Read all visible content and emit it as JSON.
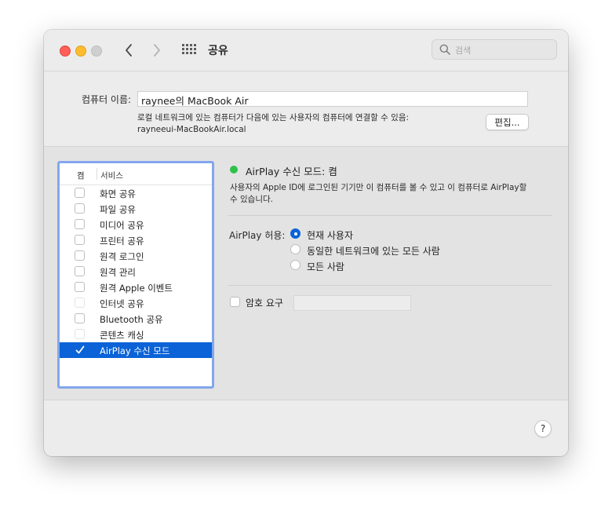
{
  "window": {
    "title": "공유"
  },
  "search": {
    "placeholder": "검색"
  },
  "computer_name": {
    "label": "컴퓨터 이름:",
    "value": "raynee의 MacBook Air",
    "description_line1": "로컬 네트워크에 있는 컴퓨터가 다음에 있는 사용자의 컴퓨터에 연결할 수 있음:",
    "description_line2": "rayneeui-MacBookAir.local",
    "edit_label": "편집..."
  },
  "services": {
    "header_on": "켬",
    "header_service": "서비스",
    "items": [
      {
        "label": "화면 공유",
        "checked": false,
        "dim": false
      },
      {
        "label": "파일 공유",
        "checked": false,
        "dim": false
      },
      {
        "label": "미디어 공유",
        "checked": false,
        "dim": false
      },
      {
        "label": "프린터 공유",
        "checked": false,
        "dim": false
      },
      {
        "label": "원격 로그인",
        "checked": false,
        "dim": false
      },
      {
        "label": "원격 관리",
        "checked": false,
        "dim": false
      },
      {
        "label": "원격 Apple 이벤트",
        "checked": false,
        "dim": false
      },
      {
        "label": "인터넷 공유",
        "checked": false,
        "dim": true
      },
      {
        "label": "Bluetooth 공유",
        "checked": false,
        "dim": false
      },
      {
        "label": "콘텐츠 캐싱",
        "checked": false,
        "dim": true
      },
      {
        "label": "AirPlay 수신 모드",
        "checked": true,
        "dim": false,
        "selected": true
      }
    ]
  },
  "detail": {
    "status": "AirPlay 수신 모드: 켬",
    "status_color": "#2ec14a",
    "desc_line1": "사용자의 Apple ID에 로그인된 기기만 이 컴퓨터를 볼 수 있고 이 컴퓨터로 AirPlay할",
    "desc_line2": "수 있습니다.",
    "allow_label": "AirPlay 허용:",
    "options": [
      {
        "label": "현재 사용자",
        "selected": true
      },
      {
        "label": "동일한 네트워크에 있는 모든 사람",
        "selected": false
      },
      {
        "label": "모든 사람",
        "selected": false
      }
    ],
    "password_label": "암호 요구",
    "password_value": ""
  },
  "help": {
    "label": "?"
  },
  "colors": {
    "accent": "#0b63d7",
    "list_focus": "#84a6ec"
  }
}
